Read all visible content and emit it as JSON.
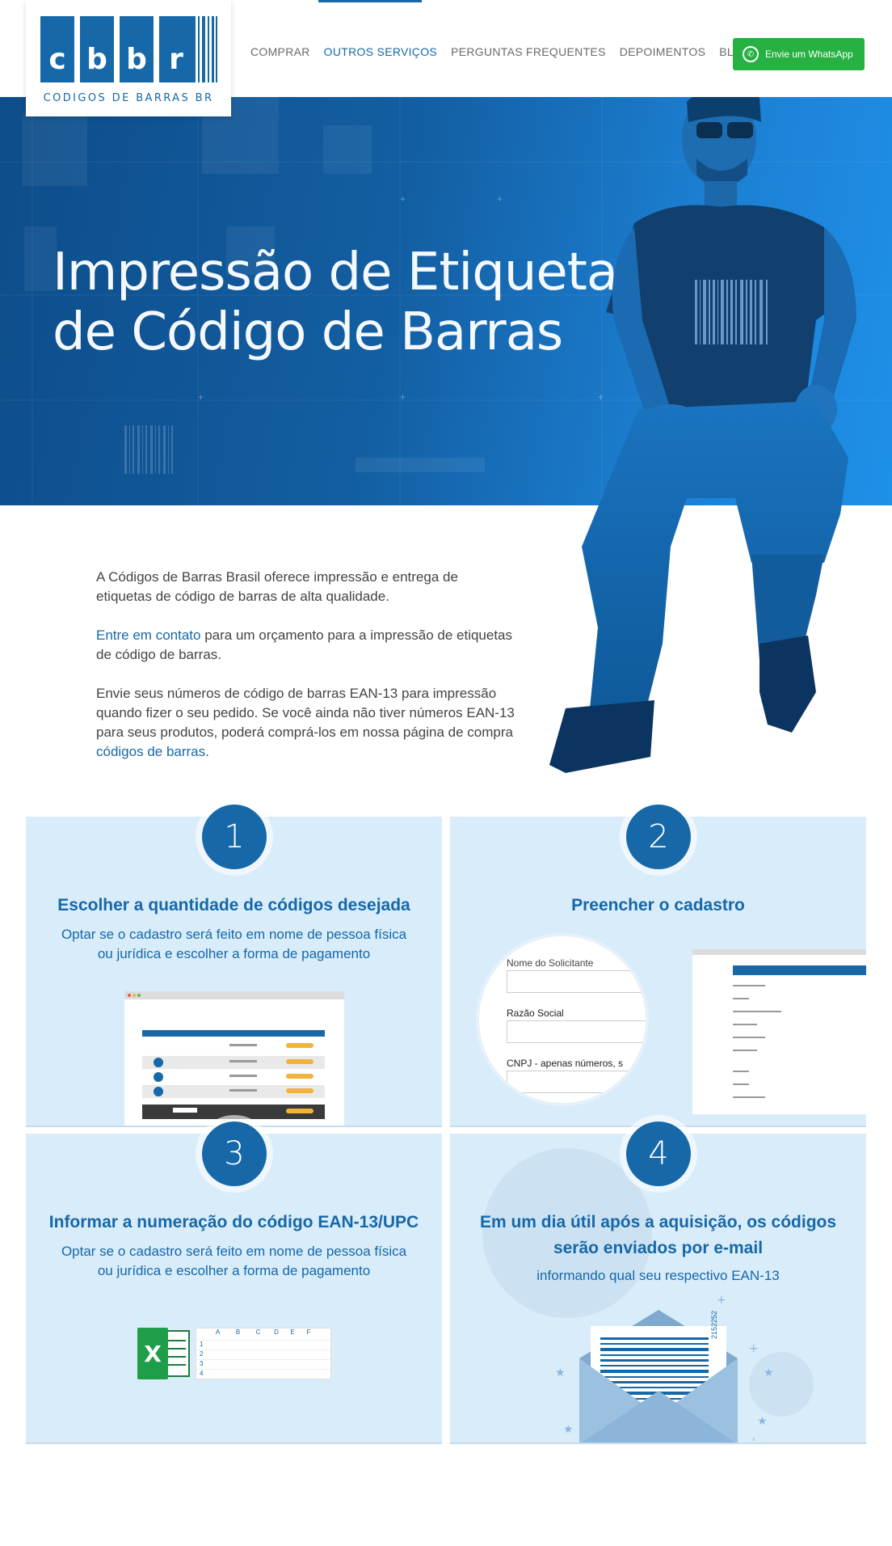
{
  "logo": {
    "letters": [
      "c",
      "b",
      "b",
      "r"
    ],
    "subtitle": "CODIGOS DE BARRAS BR"
  },
  "nav": {
    "items": [
      {
        "label": "COMPRAR",
        "active": false
      },
      {
        "label": "OUTROS SERVIÇOS",
        "active": true
      },
      {
        "label": "PERGUNTAS FREQUENTES",
        "active": false
      },
      {
        "label": "DEPOIMENTOS",
        "active": false
      },
      {
        "label": "BLOG",
        "active": false
      }
    ],
    "whatsapp_label": "Envie um WhatsApp"
  },
  "hero": {
    "title_line1": "Impressão de Etiquetas",
    "title_line2": "de Código de Barras"
  },
  "intro": {
    "p1": "A Códigos de Barras Brasil oferece impressão e entrega de etiquetas de código de barras de alta qualidade.",
    "p2_link": "Entre em contato",
    "p2_rest": " para um orçamento para a impressão de etiquetas de código de barras.",
    "p3_text": "Envie seus números de código de barras EAN-13 para impressão quando fizer o seu pedido. Se você ainda não tiver números EAN-13 para seus produtos, poderá comprá-los em nossa página de compra ",
    "p3_link": "códigos de barras",
    "p3_end": "."
  },
  "steps": [
    {
      "number": "1",
      "title": "Escolher a quantidade de códigos desejada",
      "desc_line1": "Optar se o cadastro será feito em nome de pessoa física",
      "desc_line2": "ou jurídica e escolher a forma de pagamento"
    },
    {
      "number": "2",
      "title": "Preencher o cadastro",
      "form_fields": [
        "Nome do Solicitante",
        "Razão Social",
        "CNPJ - apenas números, s"
      ]
    },
    {
      "number": "3",
      "title": "Informar a numeração do código EAN-13/UPC",
      "desc_line1": "Optar se o cadastro será feito em nome de pessoa física",
      "desc_line2": "ou jurídica e escolher a forma de pagamento",
      "sheet_columns": [
        "A",
        "B",
        "C",
        "D",
        "E",
        "F"
      ],
      "sheet_rows": [
        "1",
        "2",
        "3",
        "4"
      ]
    },
    {
      "number": "4",
      "title_line1": "Em um dia útil após a aquisição, os códigos",
      "title_line2": "serão enviados por e-mail",
      "desc": "informando qual seu respectivo EAN-13",
      "barcode_number": "2152252"
    }
  ],
  "colors": {
    "brand_blue": "#1668a8",
    "step_bg": "#d8ecfa",
    "whatsapp_green": "#26b142"
  }
}
